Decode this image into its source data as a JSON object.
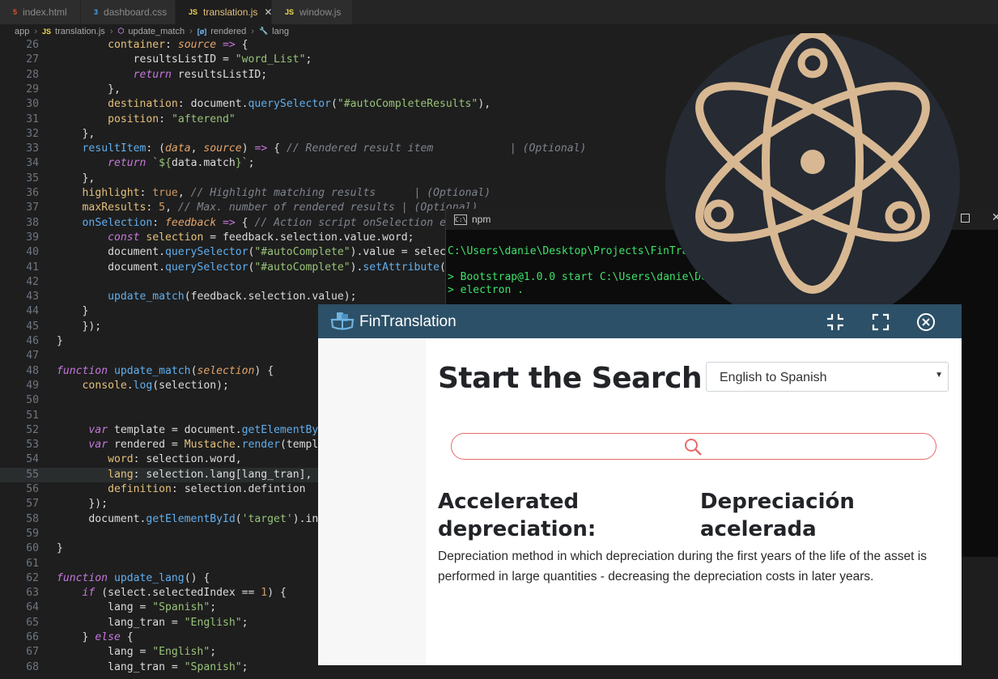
{
  "editor": {
    "tabs": [
      {
        "icon": "5",
        "icon_name": "html5-icon",
        "label": "index.html"
      },
      {
        "icon": "3",
        "icon_name": "css3-icon",
        "label": "dashboard.css"
      },
      {
        "icon": "JS",
        "icon_name": "js-icon",
        "label": "translation.js"
      },
      {
        "icon": "JS",
        "icon_name": "js-icon",
        "label": "window.js"
      }
    ],
    "breadcrumbs": [
      "app",
      "translation.js",
      "update_match",
      "rendered",
      "lang"
    ]
  },
  "terminal": {
    "title": "npm",
    "lines": [
      "C:\\Users\\danie\\Desktop\\Projects\\FinTranslation",
      "> Bootstrap@1.0.0 start C:\\Users\\danie\\Desktop\\Projects\\FinTranslation",
      "> electron ."
    ]
  },
  "app": {
    "title": "FinTranslation",
    "heading": "Start the Search",
    "language_select": "English to Spanish",
    "search_value": "",
    "result": {
      "term": "Accelerated depreciation:",
      "translation": "Depreciación acelerada",
      "definition": "Depreciation method in which depreciation during the first years of the life of the asset is performed in large quantities - decreasing the depreciation costs in later years."
    }
  },
  "colors": {
    "titlebar": "#2c5067",
    "search_border": "#e86a6a",
    "logo_bg": "#252a33",
    "logo_stroke": "#d8b892"
  }
}
